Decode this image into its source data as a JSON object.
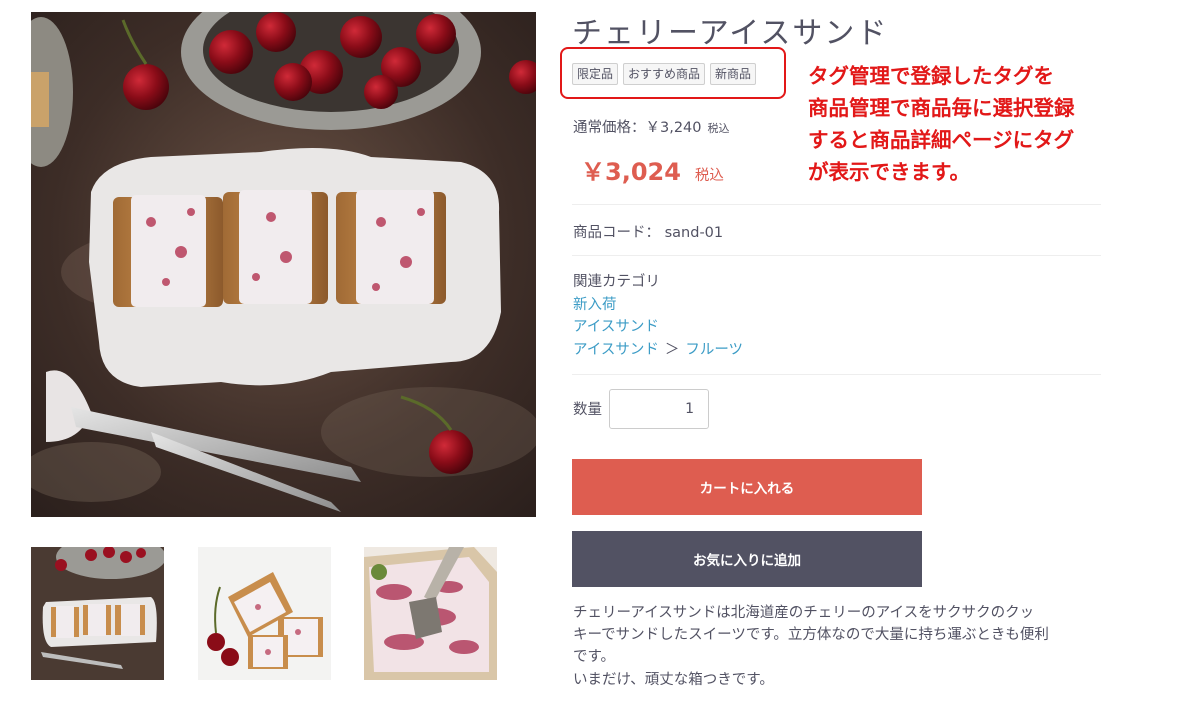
{
  "product": {
    "name": "チェリーアイスサンド",
    "tags": [
      "限定品",
      "おすすめ商品",
      "新商品"
    ],
    "regular_price_label": "通常価格：￥3,240",
    "regular_price_tax": "税込",
    "sale_price": "￥3,024",
    "sale_price_tax": "税込",
    "code_label": "商品コード：",
    "code_value": "sand-01",
    "category_heading": "関連カテゴリ",
    "categories": {
      "new_arrival": "新入荷",
      "ice_sand": "アイスサンド",
      "ice_sand_parent": "アイスサンド",
      "separator": "＞",
      "fruits": "フルーツ"
    },
    "quantity_label": "数量",
    "quantity_value": "1",
    "add_to_cart": "カートに入れる",
    "add_to_favorites": "お気に入りに追加",
    "description_lines": [
      "チェリーアイスサンドは北海道産のチェリーのアイスをサクサクのクッ",
      "キーでサンドしたスイーツです。立方体なので大量に持ち運ぶときも便利",
      "です。",
      "いまだけ、頑丈な箱つきです。"
    ]
  },
  "annotation": {
    "lines": [
      "タグ管理で登録したタグを",
      "商品管理で商品毎に選択登録",
      "すると商品詳細ページにタグ",
      "が表示できます。"
    ]
  },
  "colors": {
    "accent_red": "#de5d50",
    "dark_button": "#525263",
    "link": "#3c9cc6",
    "annotation_red": "#e21818"
  }
}
